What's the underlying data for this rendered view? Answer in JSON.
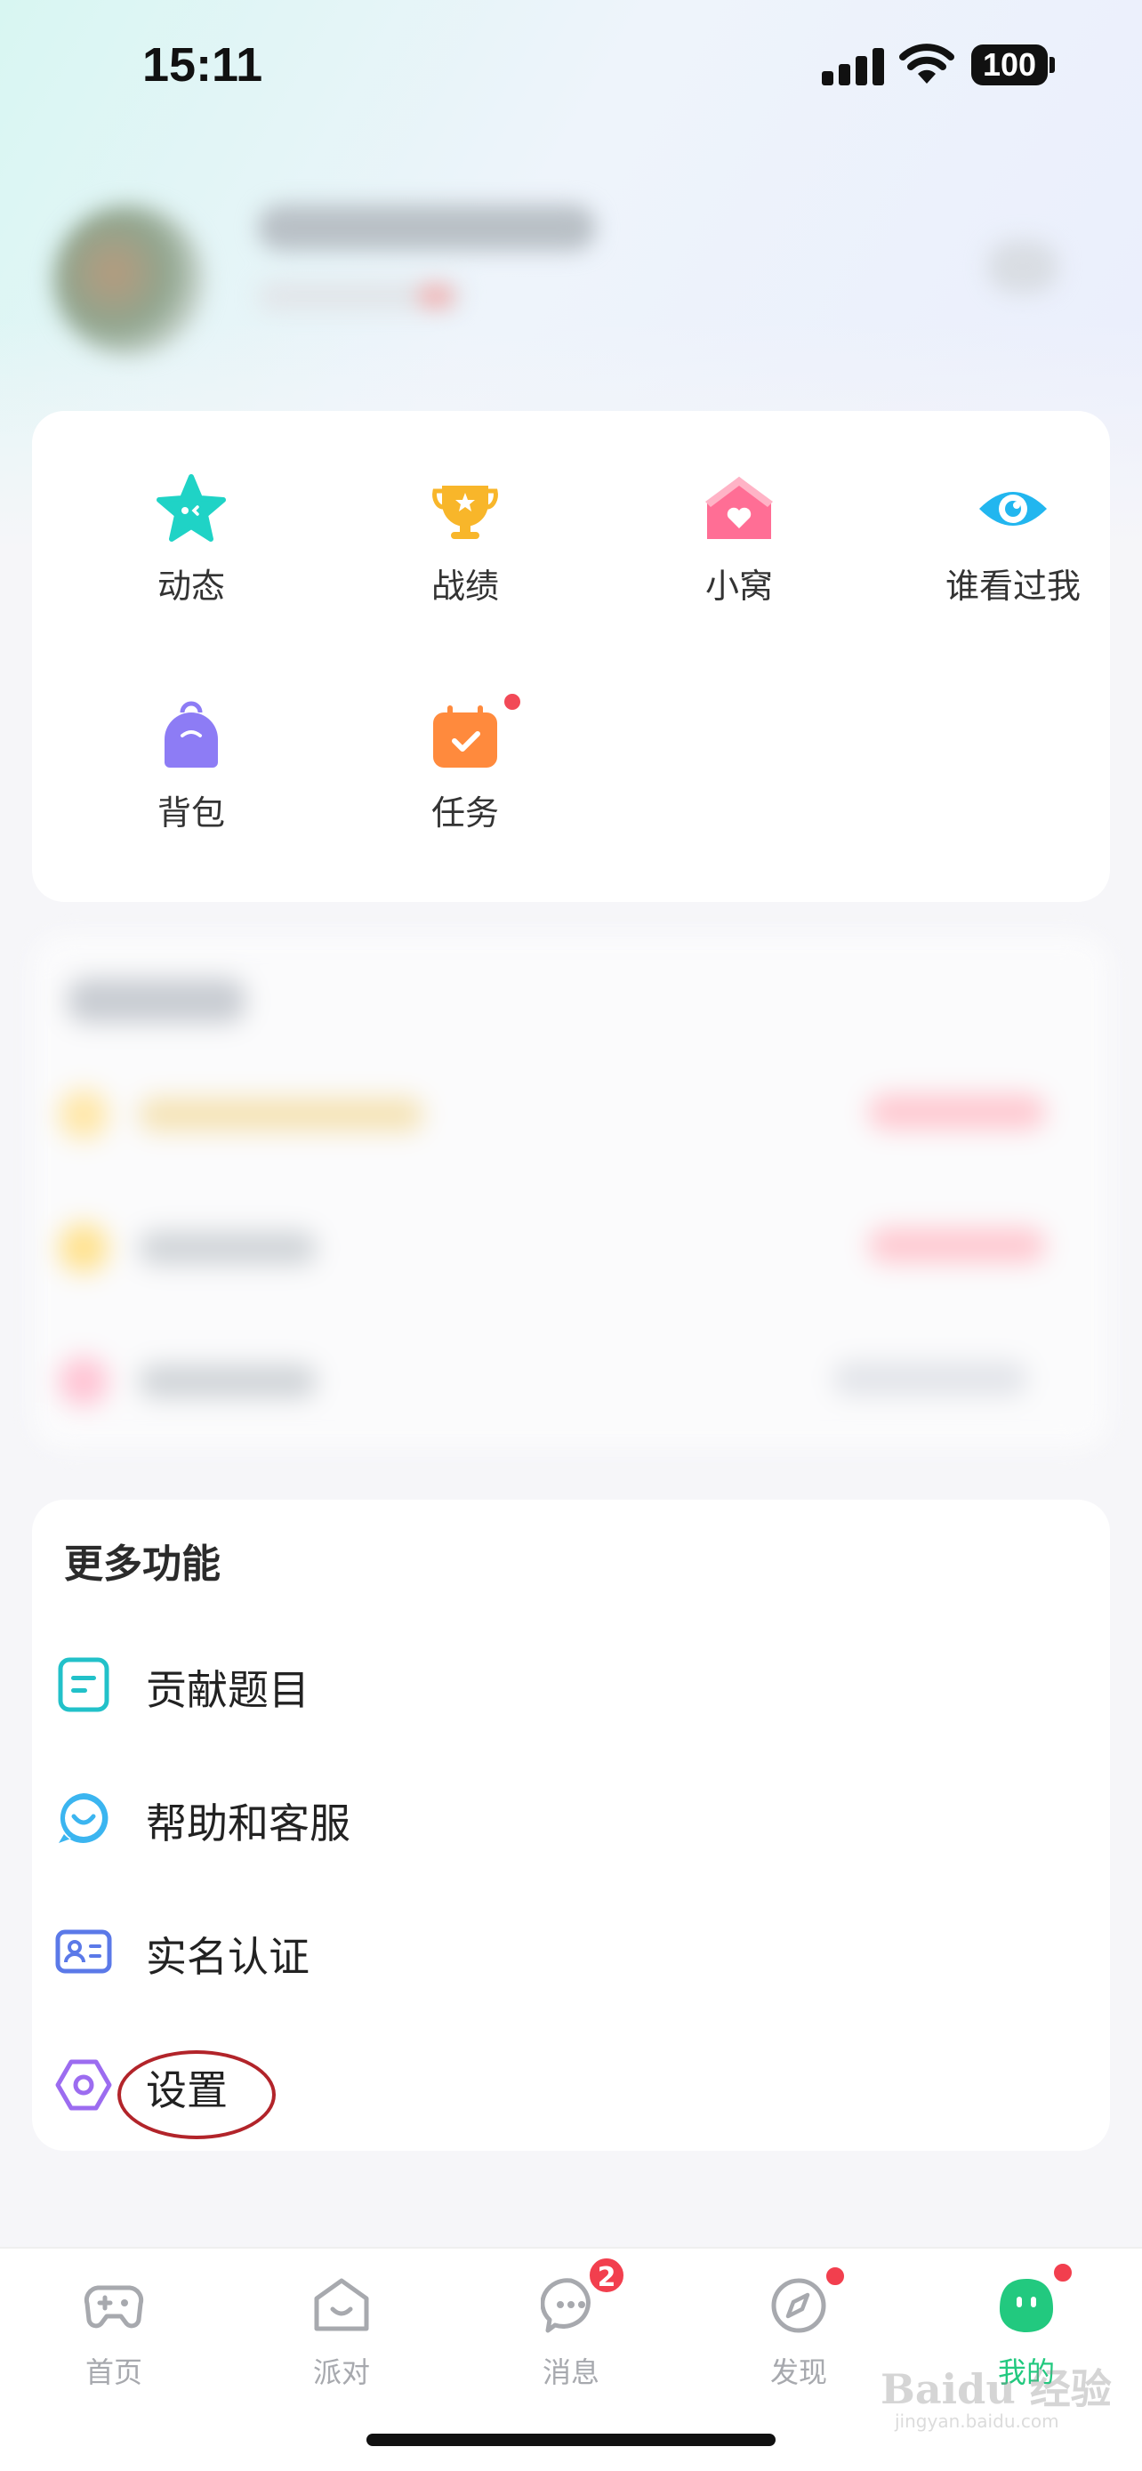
{
  "status_bar": {
    "time": "15:11",
    "battery": "100"
  },
  "quick_grid": {
    "items": [
      {
        "label": "动态",
        "icon": "star-face-icon",
        "color": "#1fd3c6"
      },
      {
        "label": "战绩",
        "icon": "trophy-icon",
        "color": "#f8b62a"
      },
      {
        "label": "小窝",
        "icon": "house-heart-icon",
        "color": "#ff6e95"
      },
      {
        "label": "谁看过我",
        "icon": "eye-icon",
        "color": "#22b6ef"
      },
      {
        "label": "背包",
        "icon": "backpack-icon",
        "color": "#8d7cf5"
      },
      {
        "label": "任务",
        "icon": "calendar-check-icon",
        "color": "#ff8a3d"
      }
    ]
  },
  "more_functions": {
    "title": "更多功能",
    "items": [
      {
        "label": "贡献题目",
        "icon": "document-icon",
        "color": "#22c1c9"
      },
      {
        "label": "帮助和客服",
        "icon": "chat-bubble-icon",
        "color": "#3bb5f0"
      },
      {
        "label": "实名认证",
        "icon": "id-card-icon",
        "color": "#5b79e8"
      },
      {
        "label": "设置",
        "icon": "hexagon-gear-icon",
        "color": "#9c6cf0"
      }
    ]
  },
  "tab_bar": {
    "tabs": [
      {
        "label": "首页",
        "icon": "gamepad-icon"
      },
      {
        "label": "派对",
        "icon": "party-house-icon"
      },
      {
        "label": "消息",
        "icon": "message-icon",
        "badge": "2"
      },
      {
        "label": "发现",
        "icon": "compass-icon"
      },
      {
        "label": "我的",
        "icon": "profile-face-icon"
      }
    ],
    "active_color": "#22c97f",
    "badge_color": "#f23f4e"
  },
  "watermark": {
    "brand": "Baidu 经验",
    "url": "jingyan.baidu.com"
  }
}
